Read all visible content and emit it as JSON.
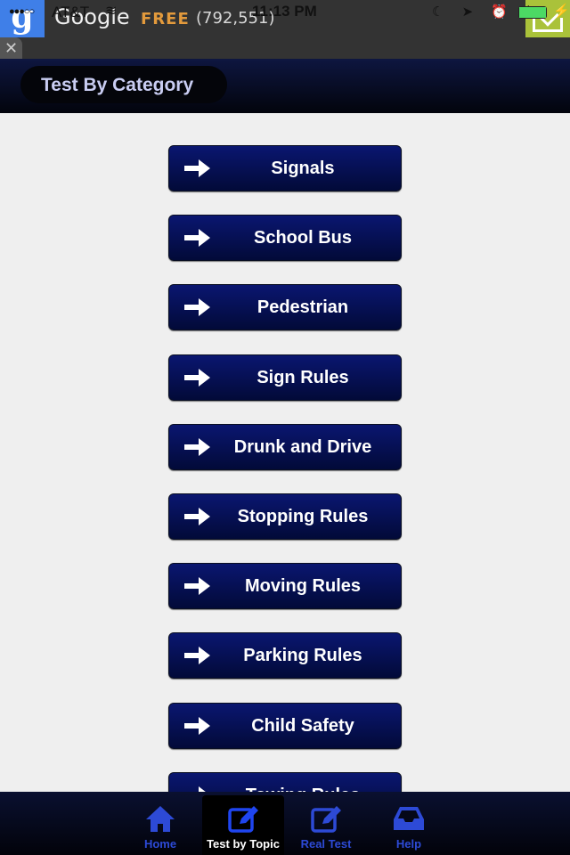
{
  "ad": {
    "logo": "g",
    "title": "Google",
    "badge": "FREE",
    "count": "(792,551)",
    "close_glyph": "✕",
    "colors": {
      "logo_bg": "#3f7fe8",
      "badge": "#e39a3c",
      "download_bg": "#aac23a"
    }
  },
  "status_bar": {
    "signal": "●●●○○",
    "carrier": "AT&T",
    "wifi_glyph": "≋",
    "time": "11:13 PM",
    "icons": "☾ ➤ ⏰ ᛒ",
    "battery_level": 1.0,
    "charging_glyph": "⚡"
  },
  "header": {
    "title": "Test By Category"
  },
  "categories": [
    {
      "label": "Signals"
    },
    {
      "label": "School Bus"
    },
    {
      "label": "Pedestrian"
    },
    {
      "label": "Sign Rules"
    },
    {
      "label": "Drunk and Drive"
    },
    {
      "label": "Stopping Rules"
    },
    {
      "label": "Moving Rules"
    },
    {
      "label": "Parking Rules"
    },
    {
      "label": "Child Safety"
    },
    {
      "label": "Towing Rules"
    }
  ],
  "tabbar": {
    "tabs": [
      {
        "label": "Home",
        "icon": "home-icon",
        "active": false
      },
      {
        "label": "Test by Topic",
        "icon": "edit-icon",
        "active": true
      },
      {
        "label": "Real Test",
        "icon": "edit-icon",
        "active": false
      },
      {
        "label": "Help",
        "icon": "inbox-icon",
        "active": false
      }
    ],
    "colors": {
      "active": "#ffffff",
      "inactive": "#2d4ad6"
    }
  }
}
